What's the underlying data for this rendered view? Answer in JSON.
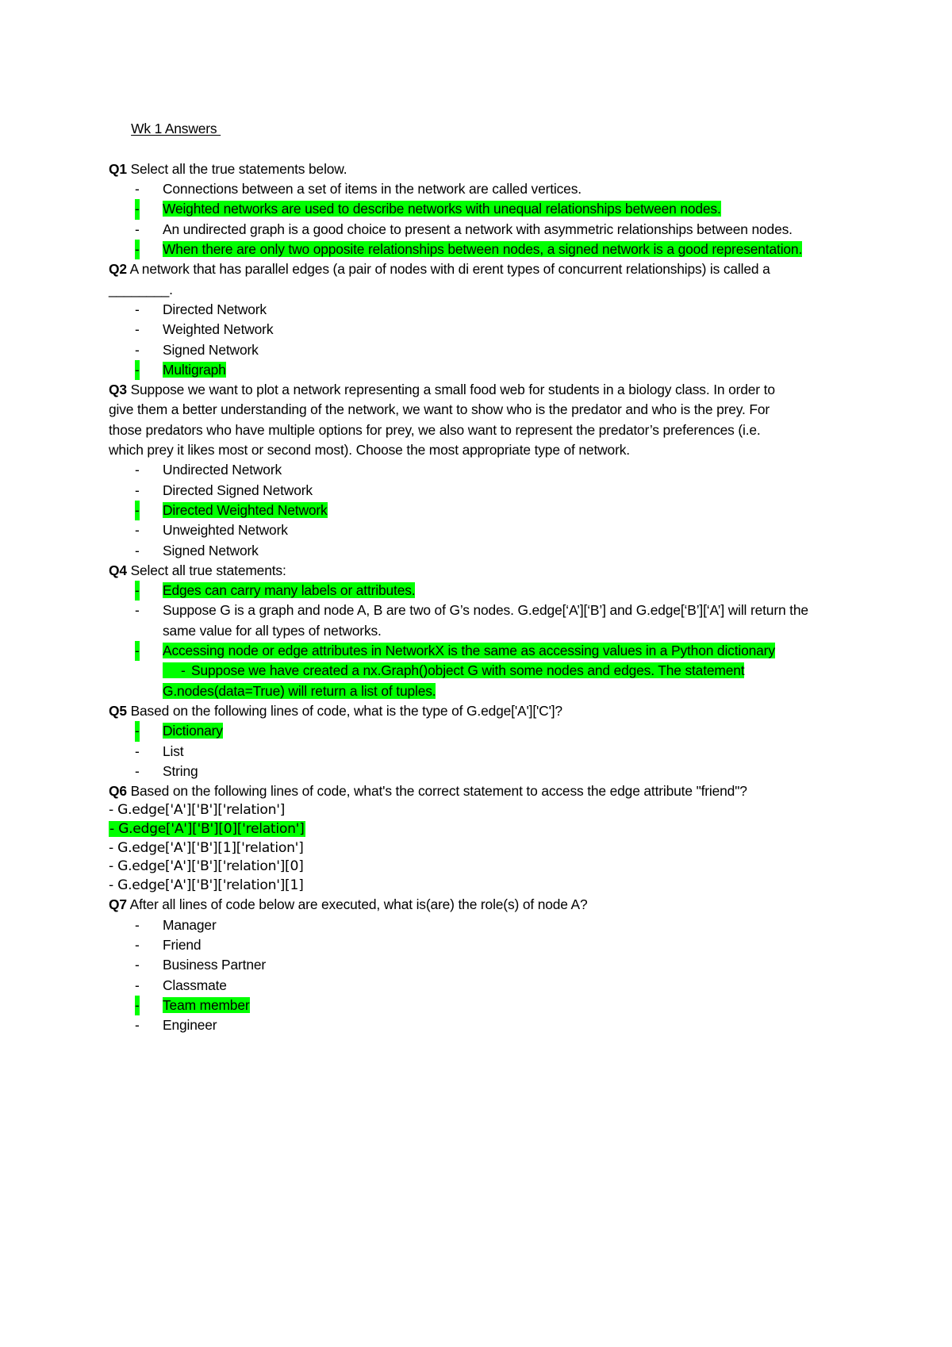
{
  "document": {
    "title": "Wk 1 Answers ",
    "highlight_color": "#00ff00",
    "questions": [
      {
        "id": "q1",
        "label": "Q1",
        "stem": " Select all the true statements below.",
        "options": [
          {
            "text": "Connections between a set of items in the network are called vertices.",
            "highlighted": false
          },
          {
            "text": "Weighted networks are used to describe networks with unequal relationships between nodes.",
            "highlighted": true
          },
          {
            "text": "An undirected graph is a good choice to present a network with asymmetric relationships between nodes.",
            "highlighted": false
          },
          {
            "text": "When there are only two opposite relationships between nodes, a signed network is a good representation.",
            "highlighted": true
          }
        ]
      },
      {
        "id": "q2",
        "label": "Q2",
        "stem": " A network that has parallel edges (a pair of nodes with di    erent types of concurrent relationships) is called a ________.",
        "options": [
          {
            "text": "Directed Network",
            "highlighted": false
          },
          {
            "text": "Weighted Network",
            "highlighted": false
          },
          {
            "text": "Signed Network",
            "highlighted": false
          },
          {
            "text": "Multigraph",
            "highlighted": true
          }
        ]
      },
      {
        "id": "q3",
        "label": "Q3",
        "stem": " Suppose we want to plot a network representing a small food web for students in a biology class. In order to give them a better understanding of the network, we want to show who is the predator and who is the prey. For those predators who have multiple options for prey, we also want to represent the predator’s preferences (i.e. which prey it likes most or second most). Choose the most appropriate type of network.",
        "options": [
          {
            "text": "Undirected Network",
            "highlighted": false
          },
          {
            "text": "Directed Signed Network",
            "highlighted": false
          },
          {
            "text": "Directed Weighted Network",
            "highlighted": true
          },
          {
            "text": "Unweighted Network",
            "highlighted": false
          },
          {
            "text": "Signed Network",
            "highlighted": false
          }
        ]
      },
      {
        "id": "q4",
        "label": "Q4",
        "stem": " Select all true statements:",
        "options": [
          {
            "text": "Edges can carry many labels or attributes.",
            "highlighted": true
          },
          {
            "text": "Suppose G is a graph and node A, B are two of G’s nodes. G.edge[‘A’][‘B’] and G.edge[‘B’][‘A’] will return the same value for all types of networks.",
            "highlighted": false
          },
          {
            "text": "Accessing node or edge attributes in NetworkX is the same as accessing values in a Python dictionary",
            "highlighted": true
          },
          {
            "text": "Suppose we have created a nx.Graph()object G with some nodes and edges. The statement G.nodes(data=True) will return a list of tuples.",
            "highlighted": true,
            "outdent": true
          }
        ]
      },
      {
        "id": "q5",
        "label": "Q5",
        "stem": " Based on the following lines of code, what is the type of G.edge['A']['C']?",
        "options": [
          {
            "text": "Dictionary",
            "highlighted": true
          },
          {
            "text": "List",
            "highlighted": false
          },
          {
            "text": "String",
            "highlighted": false
          }
        ]
      },
      {
        "id": "q6",
        "label": "Q6",
        "stem": " Based on the following lines of code, what's the correct statement to access the edge attribute \"friend\"?",
        "plain_options": [
          {
            "text": "- G.edge['A']['B']['relation']",
            "highlighted": false
          },
          {
            "text": "- G.edge['A']['B'][0]['relation']",
            "highlighted": true
          },
          {
            "text": "- G.edge['A']['B'][1]['relation']",
            "highlighted": false
          },
          {
            "text": "- G.edge['A']['B']['relation'][0]",
            "highlighted": false
          },
          {
            "text": "- G.edge['A']['B']['relation'][1]",
            "highlighted": false
          }
        ]
      },
      {
        "id": "q7",
        "label": "Q7",
        "stem": " After all lines of code below are executed, what is(are) the role(s) of node A?",
        "options": [
          {
            "text": "Manager",
            "highlighted": false
          },
          {
            "text": "Friend",
            "highlighted": false
          },
          {
            "text": "Business Partner",
            "highlighted": false
          },
          {
            "text": "Classmate",
            "highlighted": false
          },
          {
            "text": "Team member",
            "highlighted": true
          },
          {
            "text": "Engineer",
            "highlighted": false
          }
        ]
      }
    ]
  }
}
